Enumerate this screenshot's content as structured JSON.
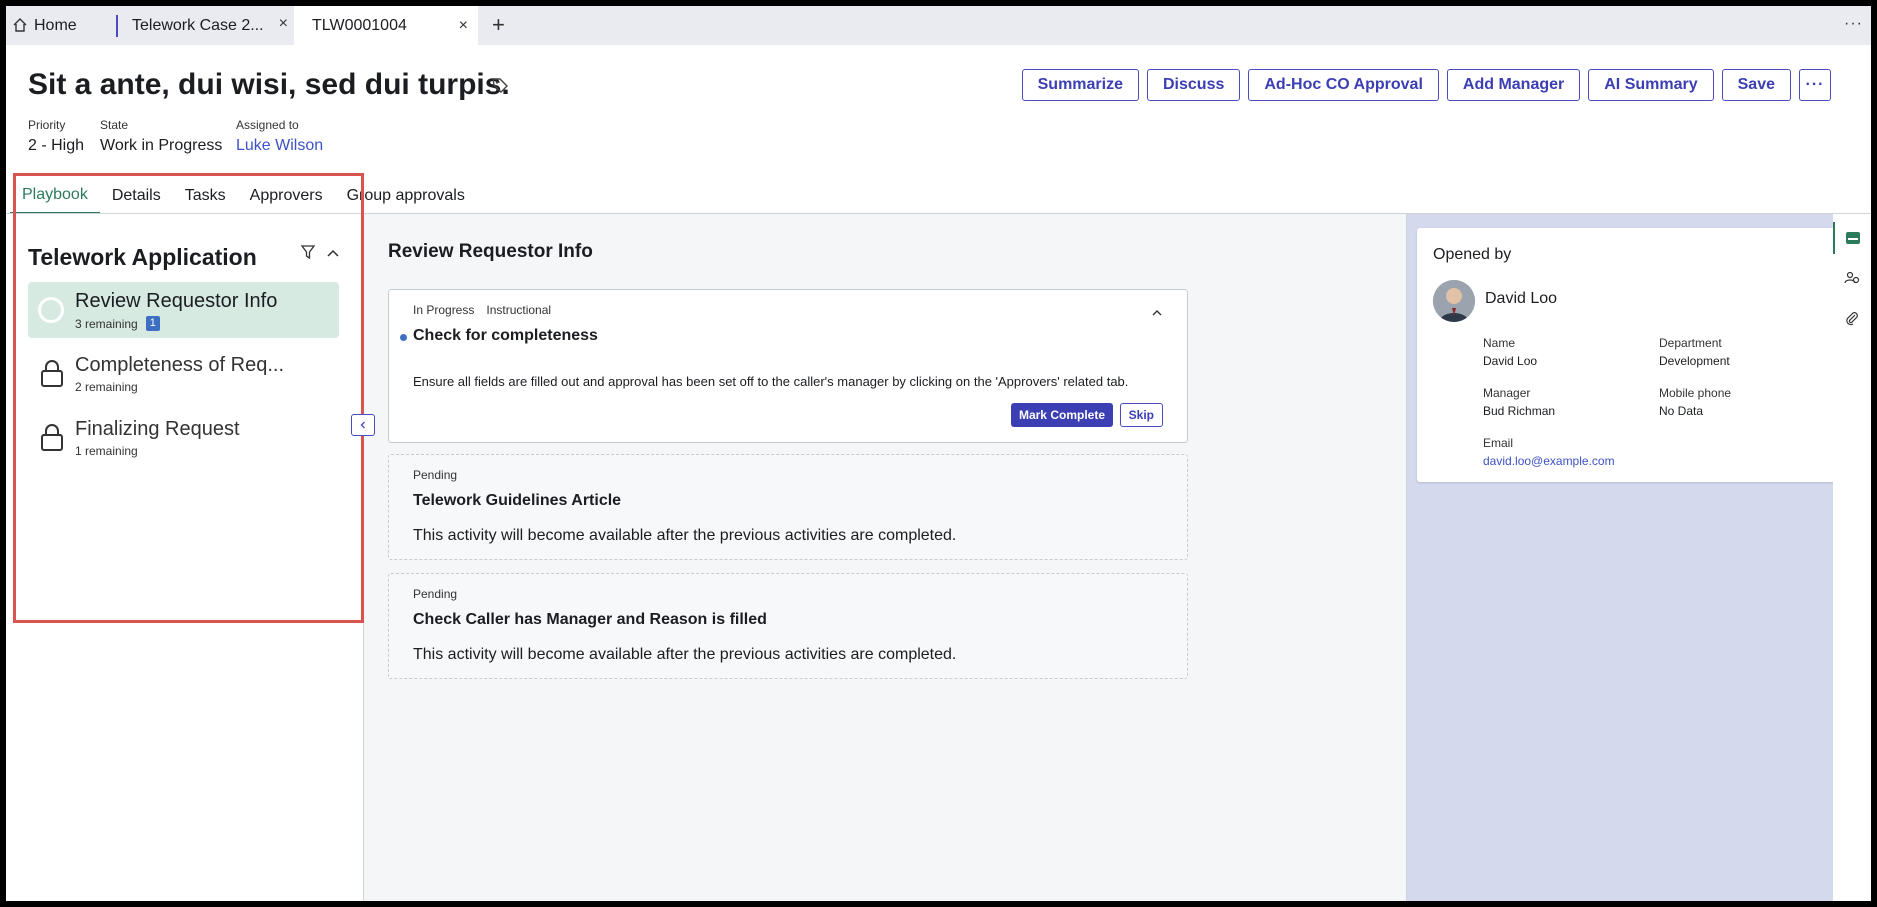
{
  "tabs": {
    "home": "Home",
    "case": "Telework Case 2...",
    "active": "TLW0001004",
    "close": "×",
    "add": "+",
    "more": "···"
  },
  "record": {
    "title": "Sit a ante, dui wisi, sed dui turpis.",
    "fields": [
      {
        "label": "Priority",
        "value": "2 - High"
      },
      {
        "label": "State",
        "value": "Work in Progress"
      },
      {
        "label": "Assigned to",
        "value": "Luke Wilson"
      }
    ]
  },
  "actions": [
    "Summarize",
    "Discuss",
    "Ad-Hoc CO Approval",
    "Add Manager",
    "AI Summary",
    "Save",
    "···"
  ],
  "form_tabs": [
    "Playbook",
    "Details",
    "Tasks",
    "Approvers",
    "Group approvals"
  ],
  "playbook": {
    "title": "Telework Application",
    "stages": [
      {
        "name": "Review Requestor Info",
        "sub": "3 remaining",
        "badge": "1"
      },
      {
        "name": "Completeness of Req...",
        "sub": "2 remaining"
      },
      {
        "name": "Finalizing Request",
        "sub": "1 remaining"
      }
    ]
  },
  "activity": {
    "title": "Review Requestor Info",
    "cards": [
      {
        "status": "In Progress",
        "type": "Instructional",
        "title": "Check for completeness",
        "desc": "Ensure all fields are filled out and approval has been set off to the caller's manager by clicking on the 'Approvers' related tab.",
        "primary": "Mark Complete",
        "secondary": "Skip"
      },
      {
        "status": "Pending",
        "title": "Telework Guidelines Article",
        "desc": "This activity will become available after the previous activities are completed."
      },
      {
        "status": "Pending",
        "title": "Check Caller has Manager and Reason is filled",
        "desc": "This activity will become available after the previous activities are completed."
      }
    ]
  },
  "opened_by": {
    "title": "Opened by",
    "name": "David Loo",
    "fields": [
      {
        "label": "Name",
        "value": "David Loo"
      },
      {
        "label": "Department",
        "value": "Development"
      },
      {
        "label": "Manager",
        "value": "Bud Richman"
      },
      {
        "label": "Mobile phone",
        "value": "No Data"
      },
      {
        "label": "Email",
        "value": "david.loo@example.com"
      }
    ]
  },
  "colors": {
    "accent": "#4a4cc0",
    "active_tab": "#2b7b5b",
    "highlight": "#d9534f"
  }
}
